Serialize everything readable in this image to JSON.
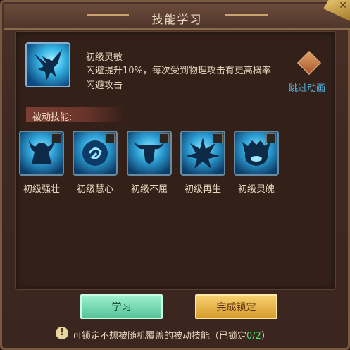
{
  "window": {
    "title": "技能学习",
    "close_icon": "close-icon",
    "accent": "#c9a270"
  },
  "skill": {
    "icon": "eagle-icon",
    "name": "初级灵敏",
    "description": "闪避提升10%，每次受到物理攻击有更高概率闪避攻击"
  },
  "skip_animation": {
    "label": "跳过动画"
  },
  "passive": {
    "label": "被动技能:",
    "items": [
      {
        "label": "初级强壮",
        "icon": "minotaur-icon",
        "checked": false
      },
      {
        "label": "初级慧心",
        "icon": "orb-icon",
        "checked": false
      },
      {
        "label": "初级不屈",
        "icon": "bull-icon",
        "checked": false
      },
      {
        "label": "初级再生",
        "icon": "leaf-icon",
        "checked": false
      },
      {
        "label": "初级灵魄",
        "icon": "spirit-beast-icon",
        "checked": false
      }
    ]
  },
  "buttons": {
    "learn": "学习",
    "complete_lock": "完成锁定"
  },
  "hint": {
    "text": "可锁定不想被随机覆盖的被动技能（已锁定",
    "count": "0/2",
    "suffix": "）"
  }
}
